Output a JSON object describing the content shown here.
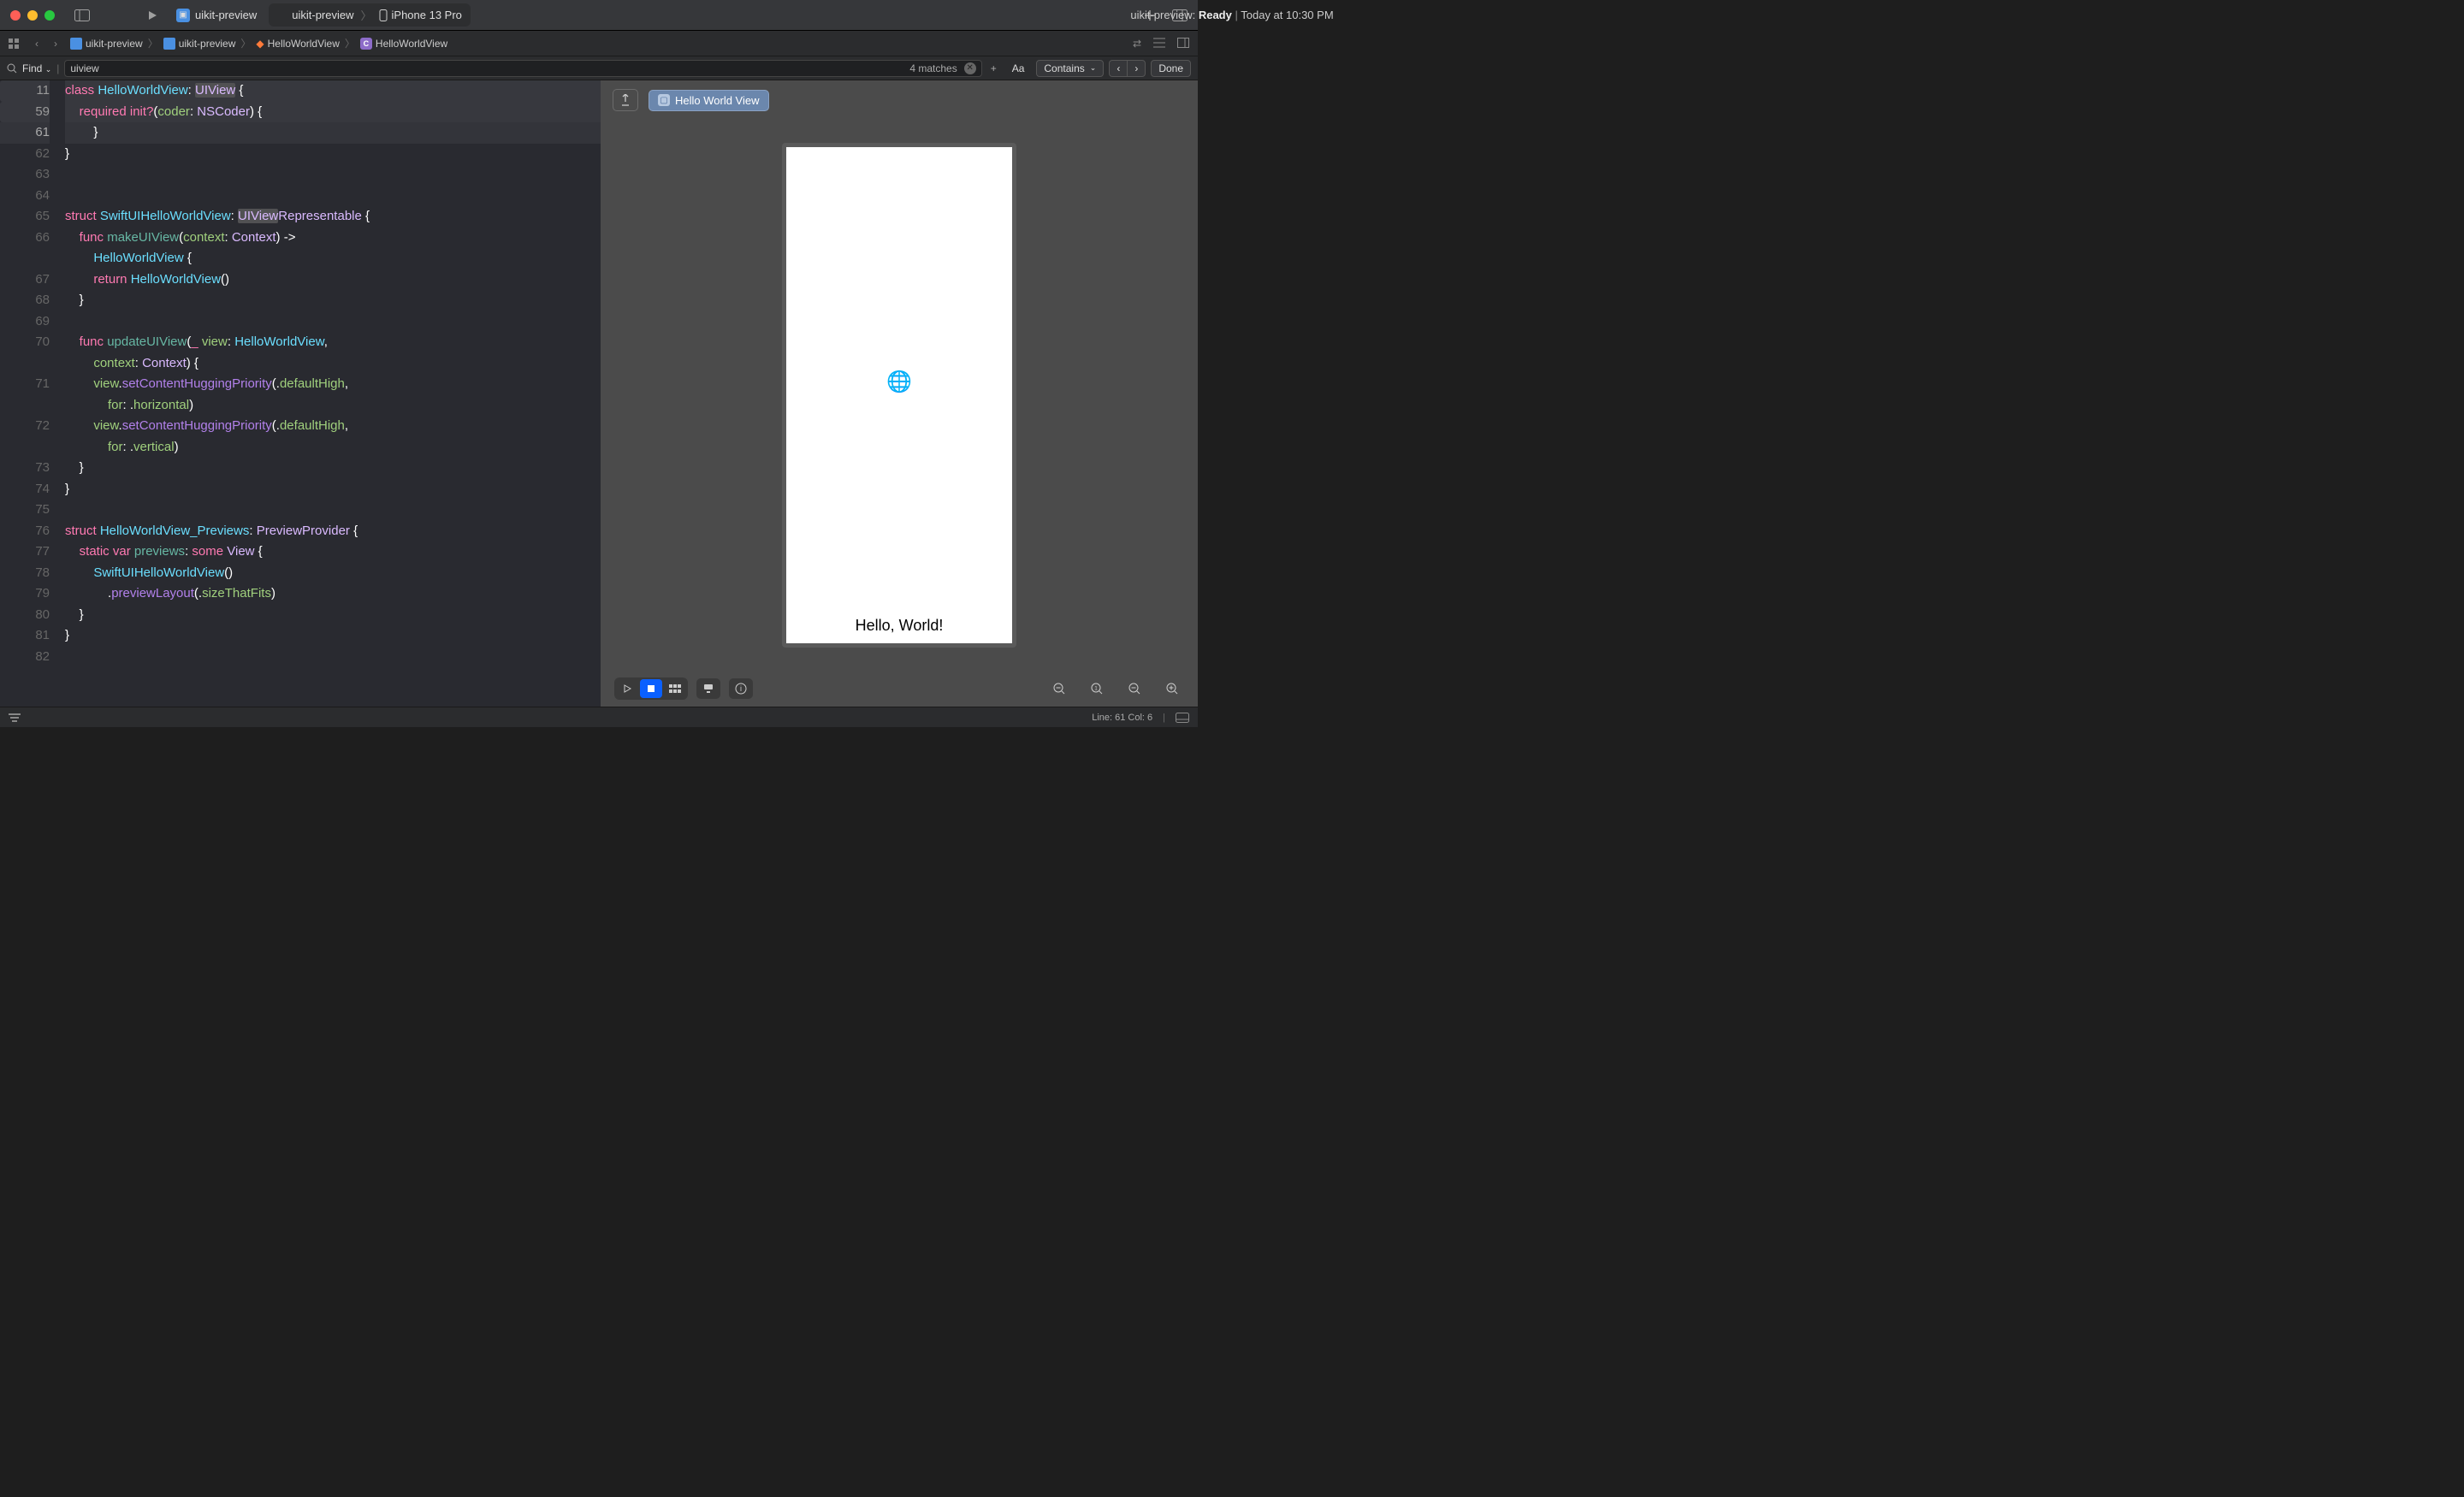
{
  "titlebar": {
    "scheme_name": "uikit-preview",
    "scheme_target_prefix": "uikit-preview",
    "device": "iPhone 13 Pro",
    "status_project": "uikit-preview:",
    "status_state": "Ready",
    "status_time": "Today at 10:30 PM"
  },
  "pathbar": {
    "crumbs": [
      "uikit-preview",
      "uikit-preview",
      "HelloWorldView",
      "HelloWorldView"
    ]
  },
  "findbar": {
    "mode": "Find",
    "query": "uiview",
    "match_count": "4 matches",
    "case_label": "Aa",
    "match_type": "Contains",
    "done": "Done"
  },
  "code": {
    "lines": [
      {
        "num": "11",
        "folded": true,
        "tokens": [
          [
            "kw",
            "class "
          ],
          [
            "type",
            "HelloWorldView"
          ],
          [
            "plain",
            ": "
          ],
          [
            "dtype",
            "UIView"
          ],
          [
            "plain",
            " {"
          ]
        ]
      },
      {
        "num": "59",
        "folded": true,
        "tokens": [
          [
            "plain",
            "    "
          ],
          [
            "kw",
            "required "
          ],
          [
            "kw2",
            "init"
          ],
          [
            "kw",
            "?"
          ],
          [
            "plain",
            "("
          ],
          [
            "id",
            "coder"
          ],
          [
            "plain",
            ": "
          ],
          [
            "dtype",
            "NSCoder"
          ],
          [
            "plain",
            ") {"
          ]
        ]
      },
      {
        "num": "61",
        "hl": true,
        "tokens": [
          [
            "plain",
            "        }"
          ]
        ]
      },
      {
        "num": "62",
        "tokens": [
          [
            "plain",
            "}"
          ]
        ]
      },
      {
        "num": "63",
        "tokens": [
          [
            "plain",
            ""
          ]
        ]
      },
      {
        "num": "64",
        "tokens": [
          [
            "plain",
            ""
          ]
        ]
      },
      {
        "num": "65",
        "tokens": [
          [
            "kw",
            "struct "
          ],
          [
            "type",
            "SwiftUIHelloWorldView"
          ],
          [
            "plain",
            ": "
          ],
          [
            "dtype",
            "UIViewRepresentable"
          ],
          [
            "plain",
            " {"
          ]
        ]
      },
      {
        "num": "66",
        "tokens": [
          [
            "plain",
            "    "
          ],
          [
            "kw",
            "func "
          ],
          [
            "func",
            "makeUIView"
          ],
          [
            "plain",
            "("
          ],
          [
            "id",
            "context"
          ],
          [
            "plain",
            ": "
          ],
          [
            "dtype",
            "Context"
          ],
          [
            "plain",
            ") ->"
          ]
        ]
      },
      {
        "num": "",
        "tokens": [
          [
            "plain",
            "        "
          ],
          [
            "type",
            "HelloWorldView"
          ],
          [
            "plain",
            " {"
          ]
        ]
      },
      {
        "num": "67",
        "tokens": [
          [
            "plain",
            "        "
          ],
          [
            "kw",
            "return "
          ],
          [
            "type",
            "HelloWorldView"
          ],
          [
            "plain",
            "()"
          ]
        ]
      },
      {
        "num": "68",
        "tokens": [
          [
            "plain",
            "    }"
          ]
        ]
      },
      {
        "num": "69",
        "tokens": [
          [
            "plain",
            ""
          ]
        ]
      },
      {
        "num": "70",
        "tokens": [
          [
            "plain",
            "    "
          ],
          [
            "kw",
            "func "
          ],
          [
            "func",
            "updateUIView"
          ],
          [
            "plain",
            "("
          ],
          [
            "kw",
            "_"
          ],
          [
            "plain",
            " "
          ],
          [
            "id",
            "view"
          ],
          [
            "plain",
            ": "
          ],
          [
            "type",
            "HelloWorldView"
          ],
          [
            "plain",
            ","
          ]
        ]
      },
      {
        "num": "",
        "tokens": [
          [
            "plain",
            "        "
          ],
          [
            "id",
            "context"
          ],
          [
            "plain",
            ": "
          ],
          [
            "dtype",
            "Context"
          ],
          [
            "plain",
            ") {"
          ]
        ]
      },
      {
        "num": "71",
        "tokens": [
          [
            "plain",
            "        "
          ],
          [
            "id",
            "view"
          ],
          [
            "plain",
            "."
          ],
          [
            "funcp",
            "setContentHuggingPriority"
          ],
          [
            "plain",
            "(."
          ],
          [
            "id",
            "defaultHigh"
          ],
          [
            "plain",
            ","
          ]
        ]
      },
      {
        "num": "",
        "tokens": [
          [
            "plain",
            "            "
          ],
          [
            "id",
            "for"
          ],
          [
            "plain",
            ": ."
          ],
          [
            "id",
            "horizontal"
          ],
          [
            "plain",
            ")"
          ]
        ]
      },
      {
        "num": "72",
        "tokens": [
          [
            "plain",
            "        "
          ],
          [
            "id",
            "view"
          ],
          [
            "plain",
            "."
          ],
          [
            "funcp",
            "setContentHuggingPriority"
          ],
          [
            "plain",
            "(."
          ],
          [
            "id",
            "defaultHigh"
          ],
          [
            "plain",
            ","
          ]
        ]
      },
      {
        "num": "",
        "tokens": [
          [
            "plain",
            "            "
          ],
          [
            "id",
            "for"
          ],
          [
            "plain",
            ": ."
          ],
          [
            "id",
            "vertical"
          ],
          [
            "plain",
            ")"
          ]
        ]
      },
      {
        "num": "73",
        "tokens": [
          [
            "plain",
            "    }"
          ]
        ]
      },
      {
        "num": "74",
        "tokens": [
          [
            "plain",
            "}"
          ]
        ]
      },
      {
        "num": "75",
        "tokens": [
          [
            "plain",
            ""
          ]
        ]
      },
      {
        "num": "76",
        "tokens": [
          [
            "kw",
            "struct "
          ],
          [
            "type",
            "HelloWorldView_Previews"
          ],
          [
            "plain",
            ": "
          ],
          [
            "dtype",
            "PreviewProvider"
          ],
          [
            "plain",
            " {"
          ]
        ]
      },
      {
        "num": "77",
        "tokens": [
          [
            "plain",
            "    "
          ],
          [
            "kw",
            "static "
          ],
          [
            "kw",
            "var "
          ],
          [
            "func",
            "previews"
          ],
          [
            "plain",
            ": "
          ],
          [
            "kw",
            "some "
          ],
          [
            "dtype",
            "View"
          ],
          [
            "plain",
            " {"
          ]
        ]
      },
      {
        "num": "78",
        "tokens": [
          [
            "plain",
            "        "
          ],
          [
            "type",
            "SwiftUIHelloWorldView"
          ],
          [
            "plain",
            "()"
          ]
        ]
      },
      {
        "num": "79",
        "tokens": [
          [
            "plain",
            "            ."
          ],
          [
            "funcp",
            "previewLayout"
          ],
          [
            "plain",
            "(."
          ],
          [
            "id",
            "sizeThatFits"
          ],
          [
            "plain",
            ")"
          ]
        ]
      },
      {
        "num": "80",
        "tokens": [
          [
            "plain",
            "    }"
          ]
        ]
      },
      {
        "num": "81",
        "tokens": [
          [
            "plain",
            "}"
          ]
        ]
      },
      {
        "num": "82",
        "tokens": [
          [
            "plain",
            ""
          ]
        ]
      }
    ],
    "search_hits": [
      "UIView",
      "UIView",
      "UIViewRepresentable",
      "UIView"
    ]
  },
  "preview": {
    "tag_label": "Hello World View",
    "hello_text": "Hello, World!"
  },
  "statusbar": {
    "line_col": "Line: 61  Col: 6"
  }
}
